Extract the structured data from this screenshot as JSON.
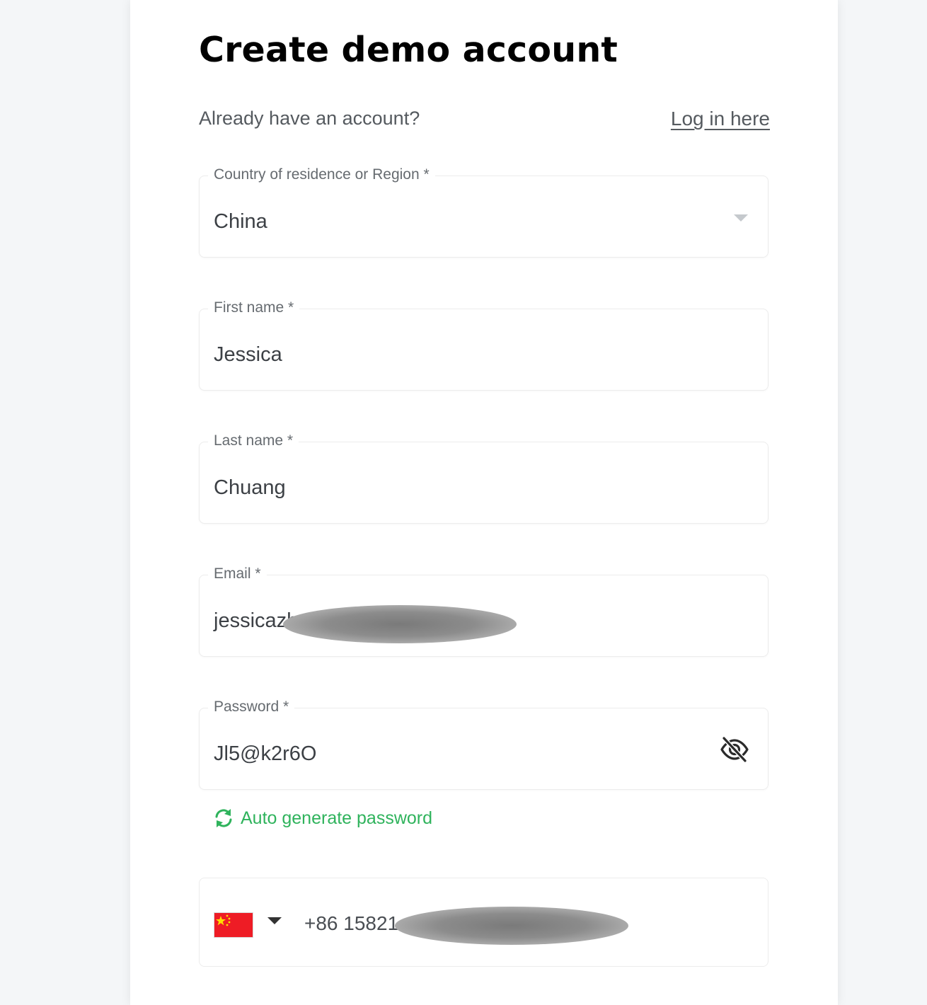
{
  "form": {
    "title": "Create demo account",
    "login_prompt": "Already have an account?",
    "login_link": "Log in here"
  },
  "fields": {
    "country": {
      "label": "Country of residence or Region *",
      "value": "China",
      "icon": "chevron-down-icon"
    },
    "first_name": {
      "label": "First name *",
      "value": "Jessica"
    },
    "last_name": {
      "label": "Last name *",
      "value": "Chuang"
    },
    "email": {
      "label": "Email *",
      "value": "jessicazh",
      "redacted": true
    },
    "password": {
      "label": "Password *",
      "value": "Jl5@k2r6O",
      "icon": "eye-slash-icon"
    },
    "phone": {
      "flag": "china-flag-icon",
      "value": "+86 15821",
      "redacted": true
    }
  },
  "autogen": {
    "label": "Auto generate password",
    "icon": "refresh-icon"
  },
  "colors": {
    "accent_green": "#2fb35c",
    "background": "#f4f6f8",
    "card": "#ffffff",
    "flag_red": "#ee1c25",
    "flag_star": "#ffde00"
  }
}
